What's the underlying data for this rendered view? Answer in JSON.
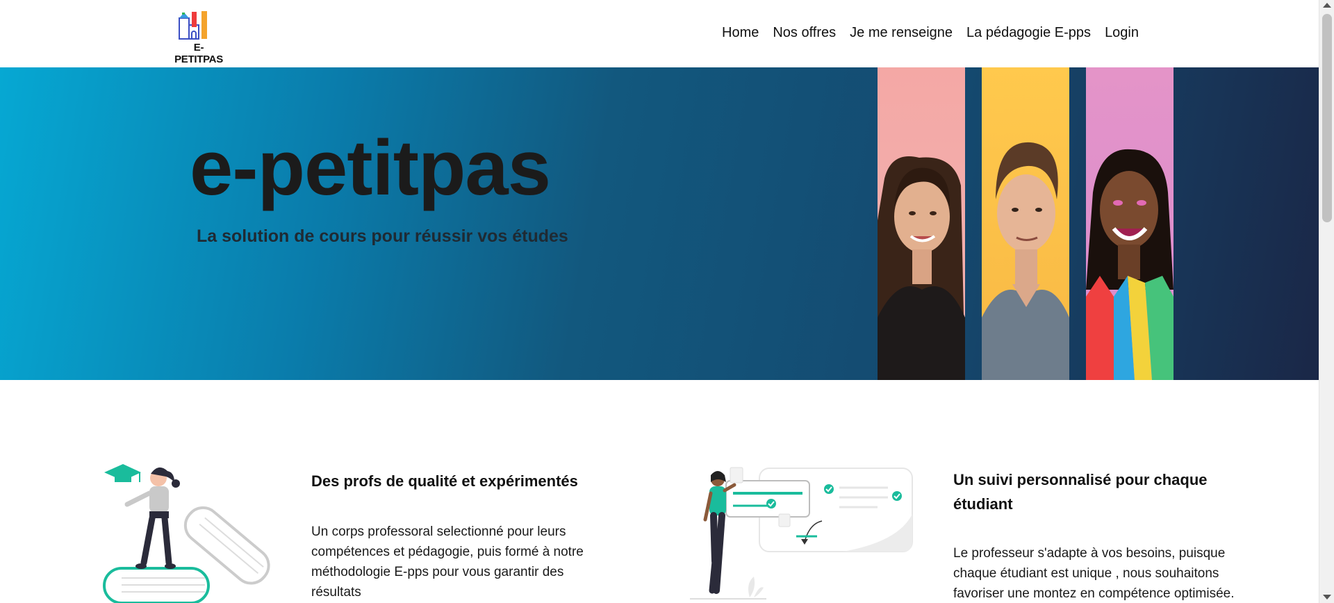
{
  "header": {
    "logo_text": "E-PETITPAS",
    "nav": [
      "Home",
      "Nos offres",
      "Je me renseigne",
      "La pédagogie E-pps",
      "Login"
    ]
  },
  "hero": {
    "title": "e-petitpas",
    "subtitle": "La solution de cours pour réussir vos études"
  },
  "features": [
    {
      "title": "Des profs de qualité et expérimentés",
      "text": "Un corps professoral selectionné pour leurs compétences et pédagogie, puis formé à notre méthodologie E-pps pour vous garantir des résultats"
    },
    {
      "title": "Un suivi personnalisé pour chaque étudiant",
      "text": "Le professeur s'adapte à vos besoins, puisque chaque étudiant est unique , nous souhaitons favoriser une montez en compétence optimisée."
    }
  ],
  "colors": {
    "accent": "#1abc9c",
    "hero_start": "#06a8d3",
    "hero_end": "#1a2747"
  },
  "icons": [
    "graduation-cap-icon",
    "check-icon"
  ]
}
